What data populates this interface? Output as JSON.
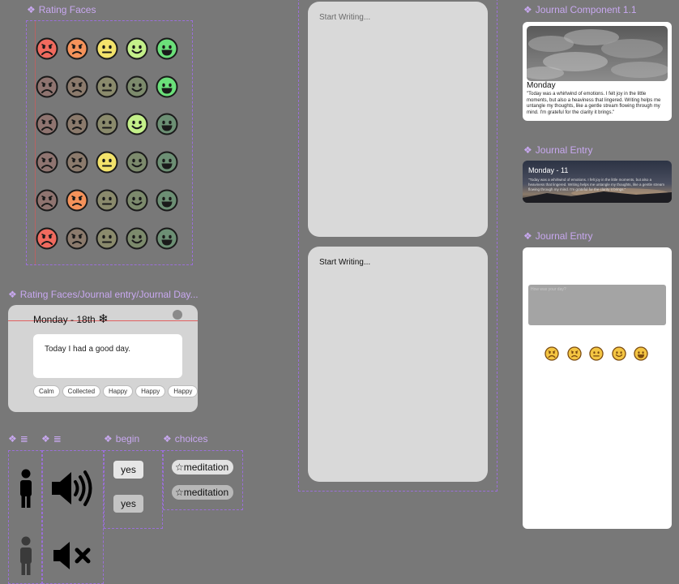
{
  "rating_faces": {
    "label": "Rating Faces",
    "rows": [
      [
        "#f06a5e",
        "#f5925a",
        "#f3e36b",
        "#c4f08a",
        "#6be07a"
      ],
      [
        "#8f7470",
        "#8b7a6c",
        "#8a8a6c",
        "#7c8a6c",
        "#6be07a"
      ],
      [
        "#8f7470",
        "#8b7a6c",
        "#8a8a6c",
        "#c4f08a",
        "#6c8f74"
      ],
      [
        "#8f7470",
        "#8b7a6c",
        "#f3e36b",
        "#7c8a6c",
        "#6c8f74"
      ],
      [
        "#8f7470",
        "#f5925a",
        "#8a8a6c",
        "#7c8a6c",
        "#6c8f74"
      ],
      [
        "#f06a5e",
        "#8b7a6c",
        "#8a8a6c",
        "#7c8a6c",
        "#6c8f74"
      ]
    ],
    "moods": [
      "very-sad",
      "sad",
      "neutral",
      "happy",
      "very-happy"
    ]
  },
  "day_card": {
    "label": "Rating Faces/Journal entry/Journal Day...",
    "title": "Monday - 18th",
    "snowflake": "❄",
    "entry_text": "Today I had a good day.",
    "tags": [
      "Calm",
      "Collected",
      "Happy",
      "Happy",
      "Happy"
    ]
  },
  "icon_frames": {
    "label_a": "≣",
    "label_b": "≣",
    "begin_label": "begin",
    "choices_label": "choices"
  },
  "begin": {
    "yes_1": "yes",
    "yes_2": "yes"
  },
  "choices": {
    "item_1": "meditation",
    "item_2": "meditation",
    "star": "☆"
  },
  "editors": {
    "top_placeholder": "Start Writing...",
    "bottom_placeholder": "Start Writing..."
  },
  "journal_component": {
    "label": "Journal Component 1.1",
    "day": "Monday",
    "text": "\"Today was a whirlwind of emotions. I felt joy in the little moments, but also a heaviness that lingered. Writing helps me untangle my thoughts, like a gentle stream flowing through my mind. I'm grateful for the clarity it brings.\""
  },
  "journal_entry_banner": {
    "label": "Journal Entry",
    "title": "Monday - 11",
    "text": "\"Today was a whirlwind of emotions. I felt joy in the little moments, but also a heaviness that lingered. Writing helps me untangle my thoughts, like a gentle stream flowing through my mind. I'm grateful for the clarity it brings.\""
  },
  "journal_entry_form": {
    "label": "Journal Entry",
    "input_placeholder": "How was your day?"
  },
  "colors": {
    "background": "#787878",
    "frame_label": "#c8a8f0",
    "frame_border": "#9b6fd9",
    "card": "#d4d4d4"
  }
}
